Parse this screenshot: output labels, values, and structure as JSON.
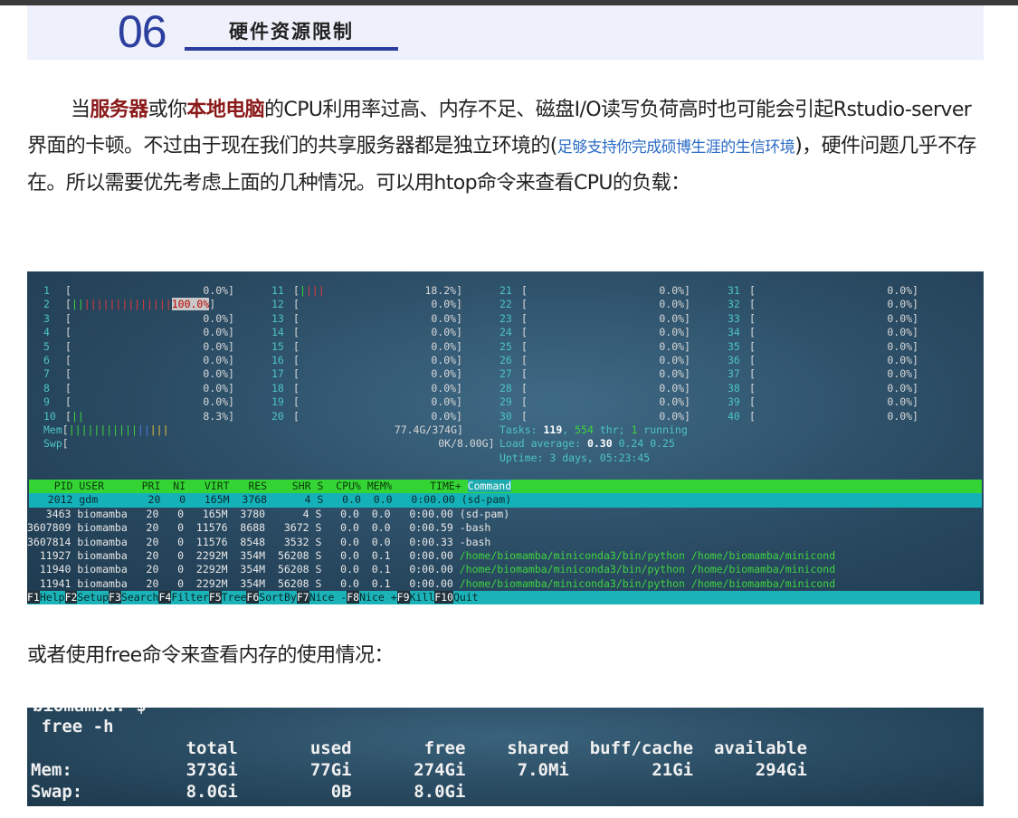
{
  "section": {
    "number": "06",
    "title": "硬件资源限制"
  },
  "paragraph1": {
    "parts": [
      {
        "t": "当",
        "s": "n"
      },
      {
        "t": "服务器",
        "s": "hl"
      },
      {
        "t": "或你",
        "s": "n"
      },
      {
        "t": "本地电脑",
        "s": "hl"
      },
      {
        "t": "的CPU利用率过高、内存不足、磁盘I/O读写负荷高时也可能会引起Rstudio-server界面的卡顿。不过由于现在我们的共享服务器都是独立环境的(",
        "s": "n"
      },
      {
        "t": "足够支持你完成硕博生涯的生信环境",
        "s": "link"
      },
      {
        "t": ")，硬件问题几乎不存在。所以需要优先考虑上面的几种情况。可以用htop命令来查看CPU的负载：",
        "s": "n"
      }
    ]
  },
  "paragraph2": "或者使用free命令来查看内存的使用情况：",
  "htop": {
    "cpus": [
      {
        "n": "1",
        "bar": "",
        "val": "0.0%"
      },
      {
        "n": "2",
        "bar": "||||||||||||||||||||",
        "val": "100.0%"
      },
      {
        "n": "3",
        "bar": "",
        "val": "0.0%"
      },
      {
        "n": "4",
        "bar": "",
        "val": "0.0%"
      },
      {
        "n": "5",
        "bar": "",
        "val": "0.0%"
      },
      {
        "n": "6",
        "bar": "",
        "val": "0.0%"
      },
      {
        "n": "7",
        "bar": "",
        "val": "0.0%"
      },
      {
        "n": "8",
        "bar": "",
        "val": "0.0%"
      },
      {
        "n": "9",
        "bar": "",
        "val": "0.0%"
      },
      {
        "n": "10",
        "bar": "||",
        "val": "8.3%"
      },
      {
        "n": "11",
        "bar": "||||",
        "val": "18.2%"
      },
      {
        "n": "12",
        "bar": "",
        "val": "0.0%"
      },
      {
        "n": "13",
        "bar": "",
        "val": "0.0%"
      },
      {
        "n": "14",
        "bar": "",
        "val": "0.0%"
      },
      {
        "n": "15",
        "bar": "",
        "val": "0.0%"
      },
      {
        "n": "16",
        "bar": "",
        "val": "0.0%"
      },
      {
        "n": "17",
        "bar": "",
        "val": "0.0%"
      },
      {
        "n": "18",
        "bar": "",
        "val": "0.0%"
      },
      {
        "n": "19",
        "bar": "",
        "val": "0.0%"
      },
      {
        "n": "20",
        "bar": "",
        "val": "0.0%"
      },
      {
        "n": "21",
        "bar": "",
        "val": "0.0%"
      },
      {
        "n": "22",
        "bar": "",
        "val": "0.0%"
      },
      {
        "n": "23",
        "bar": "",
        "val": "0.0%"
      },
      {
        "n": "24",
        "bar": "",
        "val": "0.0%"
      },
      {
        "n": "25",
        "bar": "",
        "val": "0.0%"
      },
      {
        "n": "26",
        "bar": "",
        "val": "0.0%"
      },
      {
        "n": "27",
        "bar": "",
        "val": "0.0%"
      },
      {
        "n": "28",
        "bar": "",
        "val": "0.0%"
      },
      {
        "n": "29",
        "bar": "",
        "val": "0.0%"
      },
      {
        "n": "30",
        "bar": "",
        "val": "0.0%"
      },
      {
        "n": "31",
        "bar": "",
        "val": "0.0%"
      },
      {
        "n": "32",
        "bar": "",
        "val": "0.0%"
      },
      {
        "n": "33",
        "bar": "",
        "val": "0.0%"
      },
      {
        "n": "34",
        "bar": "",
        "val": "0.0%"
      },
      {
        "n": "35",
        "bar": "",
        "val": "0.0%"
      },
      {
        "n": "36",
        "bar": "",
        "val": "0.0%"
      },
      {
        "n": "37",
        "bar": "",
        "val": "0.0%"
      },
      {
        "n": "38",
        "bar": "",
        "val": "0.0%"
      },
      {
        "n": "39",
        "bar": "",
        "val": "0.0%"
      },
      {
        "n": "40",
        "bar": "",
        "val": "0.0%"
      }
    ],
    "mem": {
      "label": "Mem",
      "bar": "||||||||||||||||",
      "val": "77.4G/374G"
    },
    "swp": {
      "label": "Swp",
      "bar": "",
      "val": "0K/8.00G"
    },
    "tasks": {
      "label": "Tasks:",
      "tasks": "119",
      "thr": "554",
      "thr_label": "thr;",
      "running": "1",
      "running_label": "running"
    },
    "load": {
      "label": "Load average:",
      "v1": "0.30",
      "v2": "0.24",
      "v3": "0.25"
    },
    "uptime": {
      "label": "Uptime:",
      "value": "3 days, 05:23:45"
    },
    "header": [
      "PID",
      "USER",
      "PRI",
      "NI",
      "VIRT",
      "RES",
      "SHR",
      "S",
      "CPU%",
      "MEM%",
      "TIME+",
      "Command"
    ],
    "processes": [
      {
        "pid": "2012",
        "user": "gdm",
        "pri": "20",
        "ni": "0",
        "virt": "165M",
        "res": "3768",
        "shr": "4",
        "s": "S",
        "cpu": "0.0",
        "mem": "0.0",
        "time": "0:00.00",
        "cmd": "(sd-pam)"
      },
      {
        "pid": "3463",
        "user": "biomamba",
        "pri": "20",
        "ni": "0",
        "virt": "165M",
        "res": "3780",
        "shr": "4",
        "s": "S",
        "cpu": "0.0",
        "mem": "0.0",
        "time": "0:00.00",
        "cmd": "(sd-pam)"
      },
      {
        "pid": "3607809",
        "user": "biomamba",
        "pri": "20",
        "ni": "0",
        "virt": "11576",
        "res": "8688",
        "shr": "3672",
        "s": "S",
        "cpu": "0.0",
        "mem": "0.0",
        "time": "0:00.59",
        "cmd": "-bash"
      },
      {
        "pid": "3607814",
        "user": "biomamba",
        "pri": "20",
        "ni": "0",
        "virt": "11576",
        "res": "8548",
        "shr": "3532",
        "s": "S",
        "cpu": "0.0",
        "mem": "0.0",
        "time": "0:00.33",
        "cmd": "-bash"
      },
      {
        "pid": "11927",
        "user": "biomamba",
        "pri": "20",
        "ni": "0",
        "virt": "2292M",
        "res": "354M",
        "shr": "56208",
        "s": "S",
        "cpu": "0.0",
        "mem": "0.1",
        "time": "0:00.00",
        "cmd": "/home/biomamba/miniconda3/bin/python /home/biomamba/minicond"
      },
      {
        "pid": "11940",
        "user": "biomamba",
        "pri": "20",
        "ni": "0",
        "virt": "2292M",
        "res": "354M",
        "shr": "56208",
        "s": "S",
        "cpu": "0.0",
        "mem": "0.1",
        "time": "0:00.00",
        "cmd": "/home/biomamba/miniconda3/bin/python /home/biomamba/minicond"
      },
      {
        "pid": "11941",
        "user": "biomamba",
        "pri": "20",
        "ni": "0",
        "virt": "2292M",
        "res": "354M",
        "shr": "56208",
        "s": "S",
        "cpu": "0.0",
        "mem": "0.1",
        "time": "0:00.00",
        "cmd": "/home/biomamba/miniconda3/bin/python /home/biomamba/minicond"
      }
    ],
    "fkeys": [
      {
        "k": "F1",
        "l": "Help"
      },
      {
        "k": "F2",
        "l": "Setup"
      },
      {
        "k": "F3",
        "l": "Search"
      },
      {
        "k": "F4",
        "l": "Filter"
      },
      {
        "k": "F5",
        "l": "Tree"
      },
      {
        "k": "F6",
        "l": "SortBy"
      },
      {
        "k": "F7",
        "l": "Nice -"
      },
      {
        "k": "F8",
        "l": "Nice +"
      },
      {
        "k": "F9",
        "l": "Kill"
      },
      {
        "k": "F10",
        "l": "Quit"
      }
    ]
  },
  "free": {
    "prompt_cut": "biomamba: $",
    "command": "free -h",
    "header": [
      "total",
      "used",
      "free",
      "shared",
      "buff/cache",
      "available"
    ],
    "rows": [
      {
        "label": "Mem:",
        "vals": [
          "373Gi",
          "77Gi",
          "274Gi",
          "7.0Mi",
          "21Gi",
          "294Gi"
        ]
      },
      {
        "label": "Swap:",
        "vals": [
          "8.0Gi",
          "0B",
          "8.0Gi",
          "",
          "",
          ""
        ]
      }
    ]
  }
}
